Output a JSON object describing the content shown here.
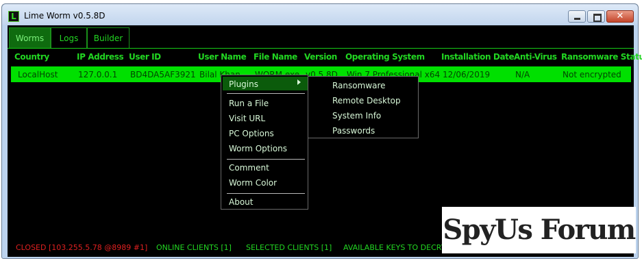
{
  "window": {
    "title": "Lime Worm v0.5.8D"
  },
  "tabs": [
    {
      "label": "Worms"
    },
    {
      "label": "Logs"
    },
    {
      "label": "Builder"
    }
  ],
  "table": {
    "headers": [
      "Country",
      "IP Address",
      "User ID",
      "User Name",
      "File Name",
      "Version",
      "Operating System",
      "Installation Date",
      "Anti-Virus",
      "Ransomware Status"
    ],
    "rows": [
      [
        "LocalHost",
        "127.0.0.1",
        "BD4DA5AF3921",
        "Bilal Khan",
        "WORM.exe",
        "v0.5.8D",
        "Win 7 Professional  x64",
        "12/06/2019",
        "N/A",
        "Not encrypted"
      ]
    ]
  },
  "context_menu": {
    "items": [
      "Plugins",
      "Run a File",
      "Visit URL",
      "PC Options",
      "Worm Options",
      "Comment",
      "Worm Color",
      "About"
    ]
  },
  "plugins_submenu": {
    "items": [
      "Ransomware",
      "Remote Desktop",
      "System Info",
      "Passwords"
    ]
  },
  "status_bar": {
    "connection": "CLOSED [103.255.5.78 @8989 #1]",
    "online": "ONLINE CLIENTS [1]",
    "selected": "SELECTED CLIENTS [1]",
    "keys": "AVAILABLE KEYS TO DECRY"
  },
  "watermark": {
    "text": "SpyUs Forum"
  },
  "colors": {
    "accent_green": "#22d622",
    "row_highlight": "#00e000",
    "status_closed": "#e02020",
    "background": "#000000"
  }
}
